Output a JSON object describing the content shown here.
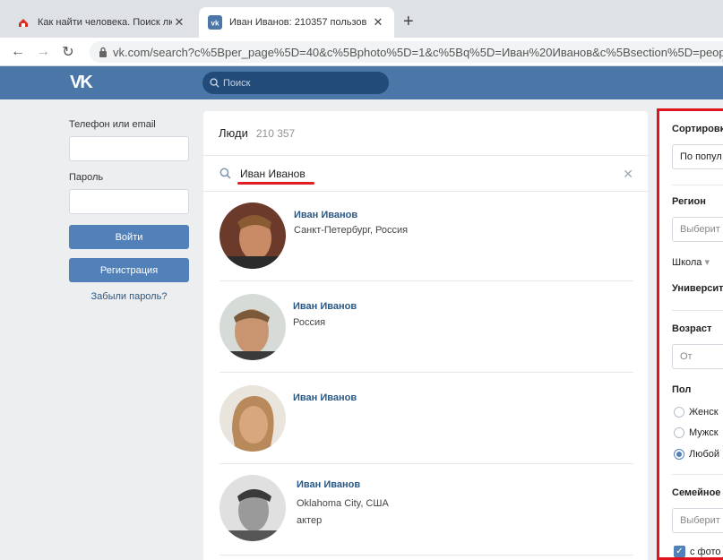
{
  "browser": {
    "tabs": [
      {
        "title": "Как найти человека. Поиск люд",
        "active": false
      },
      {
        "title": "Иван Иванов: 210357 пользов",
        "active": true
      }
    ],
    "url": "vk.com/search?c%5Bper_page%5D=40&c%5Bphoto%5D=1&c%5Bq%5D=Иван%20Иванов&c%5Bsection%5D=people"
  },
  "header": {
    "logo": "VK",
    "search_placeholder": "Поиск"
  },
  "login": {
    "phone_label": "Телефон или email",
    "password_label": "Пароль",
    "login_button": "Войти",
    "register_button": "Регистрация",
    "forgot_link": "Забыли пароль?"
  },
  "results": {
    "title": "Люди",
    "count": "210 357",
    "query": "Иван Иванов",
    "people": [
      {
        "name": "Иван Иванов",
        "info1": "Санкт-Петербург, Россия",
        "info2": ""
      },
      {
        "name": "Иван Иванов",
        "info1": "Россия",
        "info2": ""
      },
      {
        "name": "Иван Иванов",
        "info1": "",
        "info2": ""
      },
      {
        "name": "Иван Иванов",
        "info1": "Oklahoma City, США",
        "info2": "актер"
      }
    ]
  },
  "filters": {
    "sort_label": "Сортировк",
    "sort_value": "По попул",
    "region_label": "Регион",
    "region_placeholder": "Выберит",
    "school_label": "Школа",
    "university_label": "Университ",
    "age_label": "Возраст",
    "age_from": "От",
    "sex_label": "Пол",
    "sex_options": [
      "Женск",
      "Мужск",
      "Любой"
    ],
    "sex_selected": 2,
    "family_label": "Семейное",
    "family_placeholder": "Выберит",
    "photo_label": "с фото"
  },
  "colors": {
    "vk_blue": "#4a76a8",
    "highlight_red": "#e0141e"
  }
}
